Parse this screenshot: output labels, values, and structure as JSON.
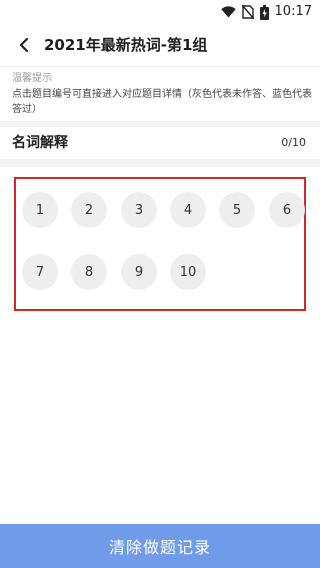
{
  "status_bar": {
    "time": "10:17",
    "icons": [
      "wifi-icon",
      "signal-no-sim-icon",
      "battery-charging-icon"
    ]
  },
  "header": {
    "title": "2021年最新热词-第1组",
    "back_icon": "arrow-left-icon"
  },
  "tip": {
    "title": "温馨提示",
    "text": "点击题目编号可直接进入对应题目详情（灰色代表未作答、蓝色代表答过）"
  },
  "section": {
    "title": "名词解释",
    "progress": "0/10"
  },
  "questions": {
    "q1": "1",
    "q2": "2",
    "q3": "3",
    "q4": "4",
    "q5": "5",
    "q6": "6",
    "q7": "7",
    "q8": "8",
    "q9": "9",
    "q10": "10",
    "unanswered_color": "#eeeeee",
    "answered_color": "#6f9be8"
  },
  "footer": {
    "clear_button_label": "清除做题记录"
  },
  "colors": {
    "accent": "#6f9be8",
    "highlight_border": "#d32626"
  }
}
